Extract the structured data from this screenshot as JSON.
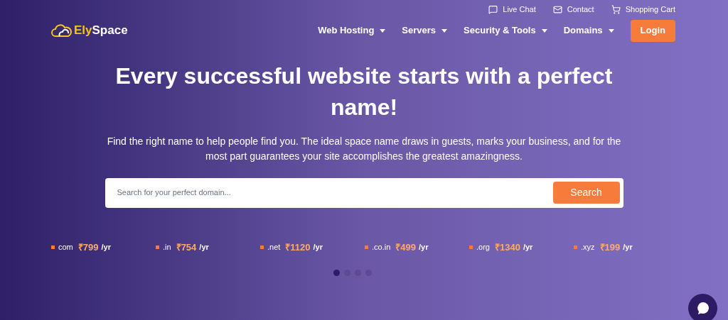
{
  "top_links": [
    {
      "kind": "chat",
      "label": "Live Chat"
    },
    {
      "kind": "mail",
      "label": "Contact"
    },
    {
      "kind": "cart",
      "label": "Shopping Cart"
    }
  ],
  "logo": {
    "first": "Ely",
    "second": "Space"
  },
  "nav": [
    {
      "label": "Web Hosting",
      "dropdown": true
    },
    {
      "label": "Servers",
      "dropdown": true
    },
    {
      "label": "Security & Tools",
      "dropdown": true
    },
    {
      "label": "Domains",
      "dropdown": true
    }
  ],
  "login": "Login",
  "headline": "Every successful website starts with a perfect name!",
  "subtitle": "Find the right name to help people find you. The ideal space name draws in guests, marks your business, and for the most part guarantees your site accomplishes the greatest amazingness.",
  "search": {
    "placeholder": "Search for your perfect domain...",
    "button": "Search"
  },
  "prices": [
    {
      "tld": "com",
      "price": "₹799",
      "unit": "/yr"
    },
    {
      "tld": ".in",
      "price": "₹754",
      "unit": "/yr"
    },
    {
      "tld": ".net",
      "price": "₹1120",
      "unit": "/yr"
    },
    {
      "tld": ".co.in",
      "price": "₹499",
      "unit": "/yr"
    },
    {
      "tld": ".org",
      "price": "₹1340",
      "unit": "/yr"
    },
    {
      "tld": ".xyz",
      "price": "₹199",
      "unit": "/yr"
    }
  ],
  "dots": [
    {
      "selected": true
    },
    {
      "selected": false
    },
    {
      "selected": false
    },
    {
      "selected": false
    }
  ]
}
